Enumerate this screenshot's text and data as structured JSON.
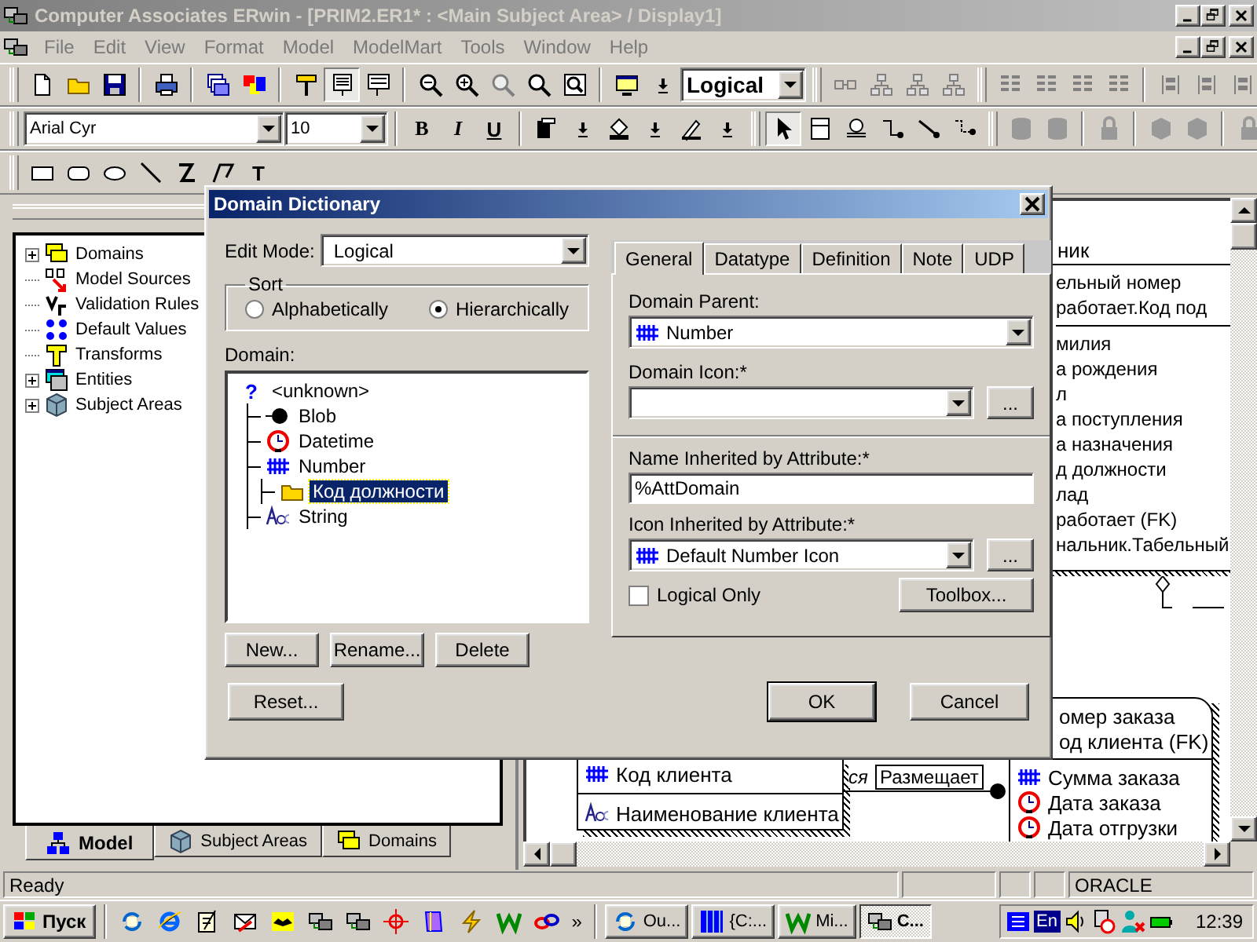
{
  "window": {
    "title": "Computer Associates ERwin - [PRIM2.ER1* : <Main Subject Area> / Display1]"
  },
  "menu": [
    "File",
    "Edit",
    "View",
    "Format",
    "Model",
    "ModelMart",
    "Tools",
    "Window",
    "Help"
  ],
  "toolbar": {
    "display_level": "Logical",
    "font": "Arial Cyr",
    "font_size": "10",
    "bold": "B",
    "italic": "I",
    "underline": "U",
    "text_tool": "T"
  },
  "model_tree": [
    {
      "label": "Domains",
      "kind": "domains",
      "has_children": true
    },
    {
      "label": "Model Sources",
      "kind": "sources",
      "has_children": false
    },
    {
      "label": "Validation Rules",
      "kind": "rules",
      "has_children": false
    },
    {
      "label": "Default Values",
      "kind": "defaults",
      "has_children": false
    },
    {
      "label": "Transforms",
      "kind": "transforms",
      "has_children": false
    },
    {
      "label": "Entities",
      "kind": "entities",
      "has_children": true
    },
    {
      "label": "Subject Areas",
      "kind": "subject_areas",
      "has_children": true
    }
  ],
  "model_tabs": [
    {
      "label": "Model",
      "kind": "model",
      "selected": true
    },
    {
      "label": "Subject Areas",
      "kind": "subject_areas",
      "selected": false
    },
    {
      "label": "Domains",
      "kind": "domains",
      "selected": false
    }
  ],
  "diagram": {
    "employee": {
      "name": "ник",
      "keys": [
        "ельный номер",
        "работает.Код под"
      ],
      "attributes": [
        "милия",
        "а рождения",
        "л",
        "а поступления",
        "а назначения",
        "д должности",
        "лад",
        "работает (FK)",
        "нальник.Табельный"
      ]
    },
    "client": {
      "keys": [
        {
          "label": "Код клиента",
          "kind": "number"
        }
      ],
      "attributes": [
        {
          "label": "Наименование клиента",
          "kind": "string"
        }
      ]
    },
    "relationship": {
      "hidden_label": "ся",
      "label": "Размещает"
    },
    "order": {
      "keys": [
        {
          "label": "омер заказа"
        },
        {
          "label": "од клиента (FK)"
        }
      ],
      "attributes": [
        {
          "label": "Сумма заказа",
          "kind": "number"
        },
        {
          "label": "Дата заказа",
          "kind": "datetime"
        },
        {
          "label": "Дата отгрузки",
          "kind": "datetime"
        }
      ]
    }
  },
  "dialog": {
    "title": "Domain Dictionary",
    "edit_mode_label": "Edit Mode:",
    "edit_mode": "Logical",
    "sort_label": "Sort",
    "sort_options": [
      {
        "label": "Alphabetically",
        "selected": false
      },
      {
        "label": "Hierarchically",
        "selected": true
      }
    ],
    "domain_label": "Domain:",
    "domains": [
      {
        "label": "<unknown>",
        "kind": "glyph",
        "glyph": "?",
        "selected": false,
        "children": [
          {
            "label": "Blob",
            "kind": "blob",
            "selected": false
          },
          {
            "label": "Datetime",
            "kind": "datetime",
            "selected": false
          },
          {
            "label": "Number",
            "kind": "number",
            "selected": false,
            "children": [
              {
                "label": "Код должности",
                "kind": "folder",
                "selected": true
              }
            ]
          },
          {
            "label": "String",
            "kind": "string",
            "selected": false
          }
        ]
      }
    ],
    "list_buttons": [
      "New...",
      "Rename...",
      "Delete"
    ],
    "reset": "Reset...",
    "tabs": [
      {
        "label": "General",
        "selected": true
      },
      {
        "label": "Datatype",
        "selected": false
      },
      {
        "label": "Definition",
        "selected": false
      },
      {
        "label": "Note",
        "selected": false
      },
      {
        "label": "UDP",
        "selected": false
      }
    ],
    "parent_label": "Domain Parent:",
    "parent": {
      "label": "Number",
      "kind": "number"
    },
    "icon_label": "Domain Icon:*",
    "browse_buttons": [
      "...",
      "..."
    ],
    "name_label": "Name Inherited by Attribute:*",
    "name_value": "%AttDomain",
    "icon_inherited_label": "Icon Inherited by Attribute:*",
    "icon_inherited": {
      "label": "Default Number Icon",
      "kind": "number"
    },
    "logical_only": {
      "label": "Logical Only",
      "checked": false
    },
    "toolbox": "Toolbox...",
    "ok": "OK",
    "cancel": "Cancel"
  },
  "status_bar": {
    "message": "Ready",
    "database": "ORACLE"
  },
  "taskbar": {
    "start": "Пуск",
    "more": "»",
    "tasks": [
      {
        "label": "Ou...",
        "kind": "sync",
        "selected": false
      },
      {
        "label": "{C:...",
        "kind": "columns",
        "selected": false
      },
      {
        "label": "Mi...",
        "kind": "word",
        "selected": false
      },
      {
        "label": "C...",
        "kind": "erwin",
        "selected": true
      }
    ],
    "language": "En",
    "clock": "12:39"
  }
}
